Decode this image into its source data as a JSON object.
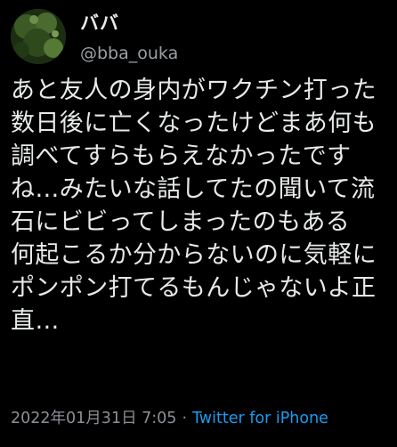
{
  "tweet": {
    "display_name": "ババ",
    "handle": "@bba_ouka",
    "text": "あと友人の身内がワクチン打った数日後に亡くなったけどまあ何も調べてすらもらえなかったですね…みたいな話してたの聞いて流石にビビってしまったのもある　何起こるか分からないのに気軽にポンポン打てるもんじゃないよ正直…",
    "timestamp": "2022年01月31日 7:05",
    "separator": "·",
    "source": "Twitter for iPhone"
  },
  "colors": {
    "background": "#000000",
    "text": "#e7e9ea",
    "muted": "#8b9096",
    "link": "#1d9bf0"
  }
}
